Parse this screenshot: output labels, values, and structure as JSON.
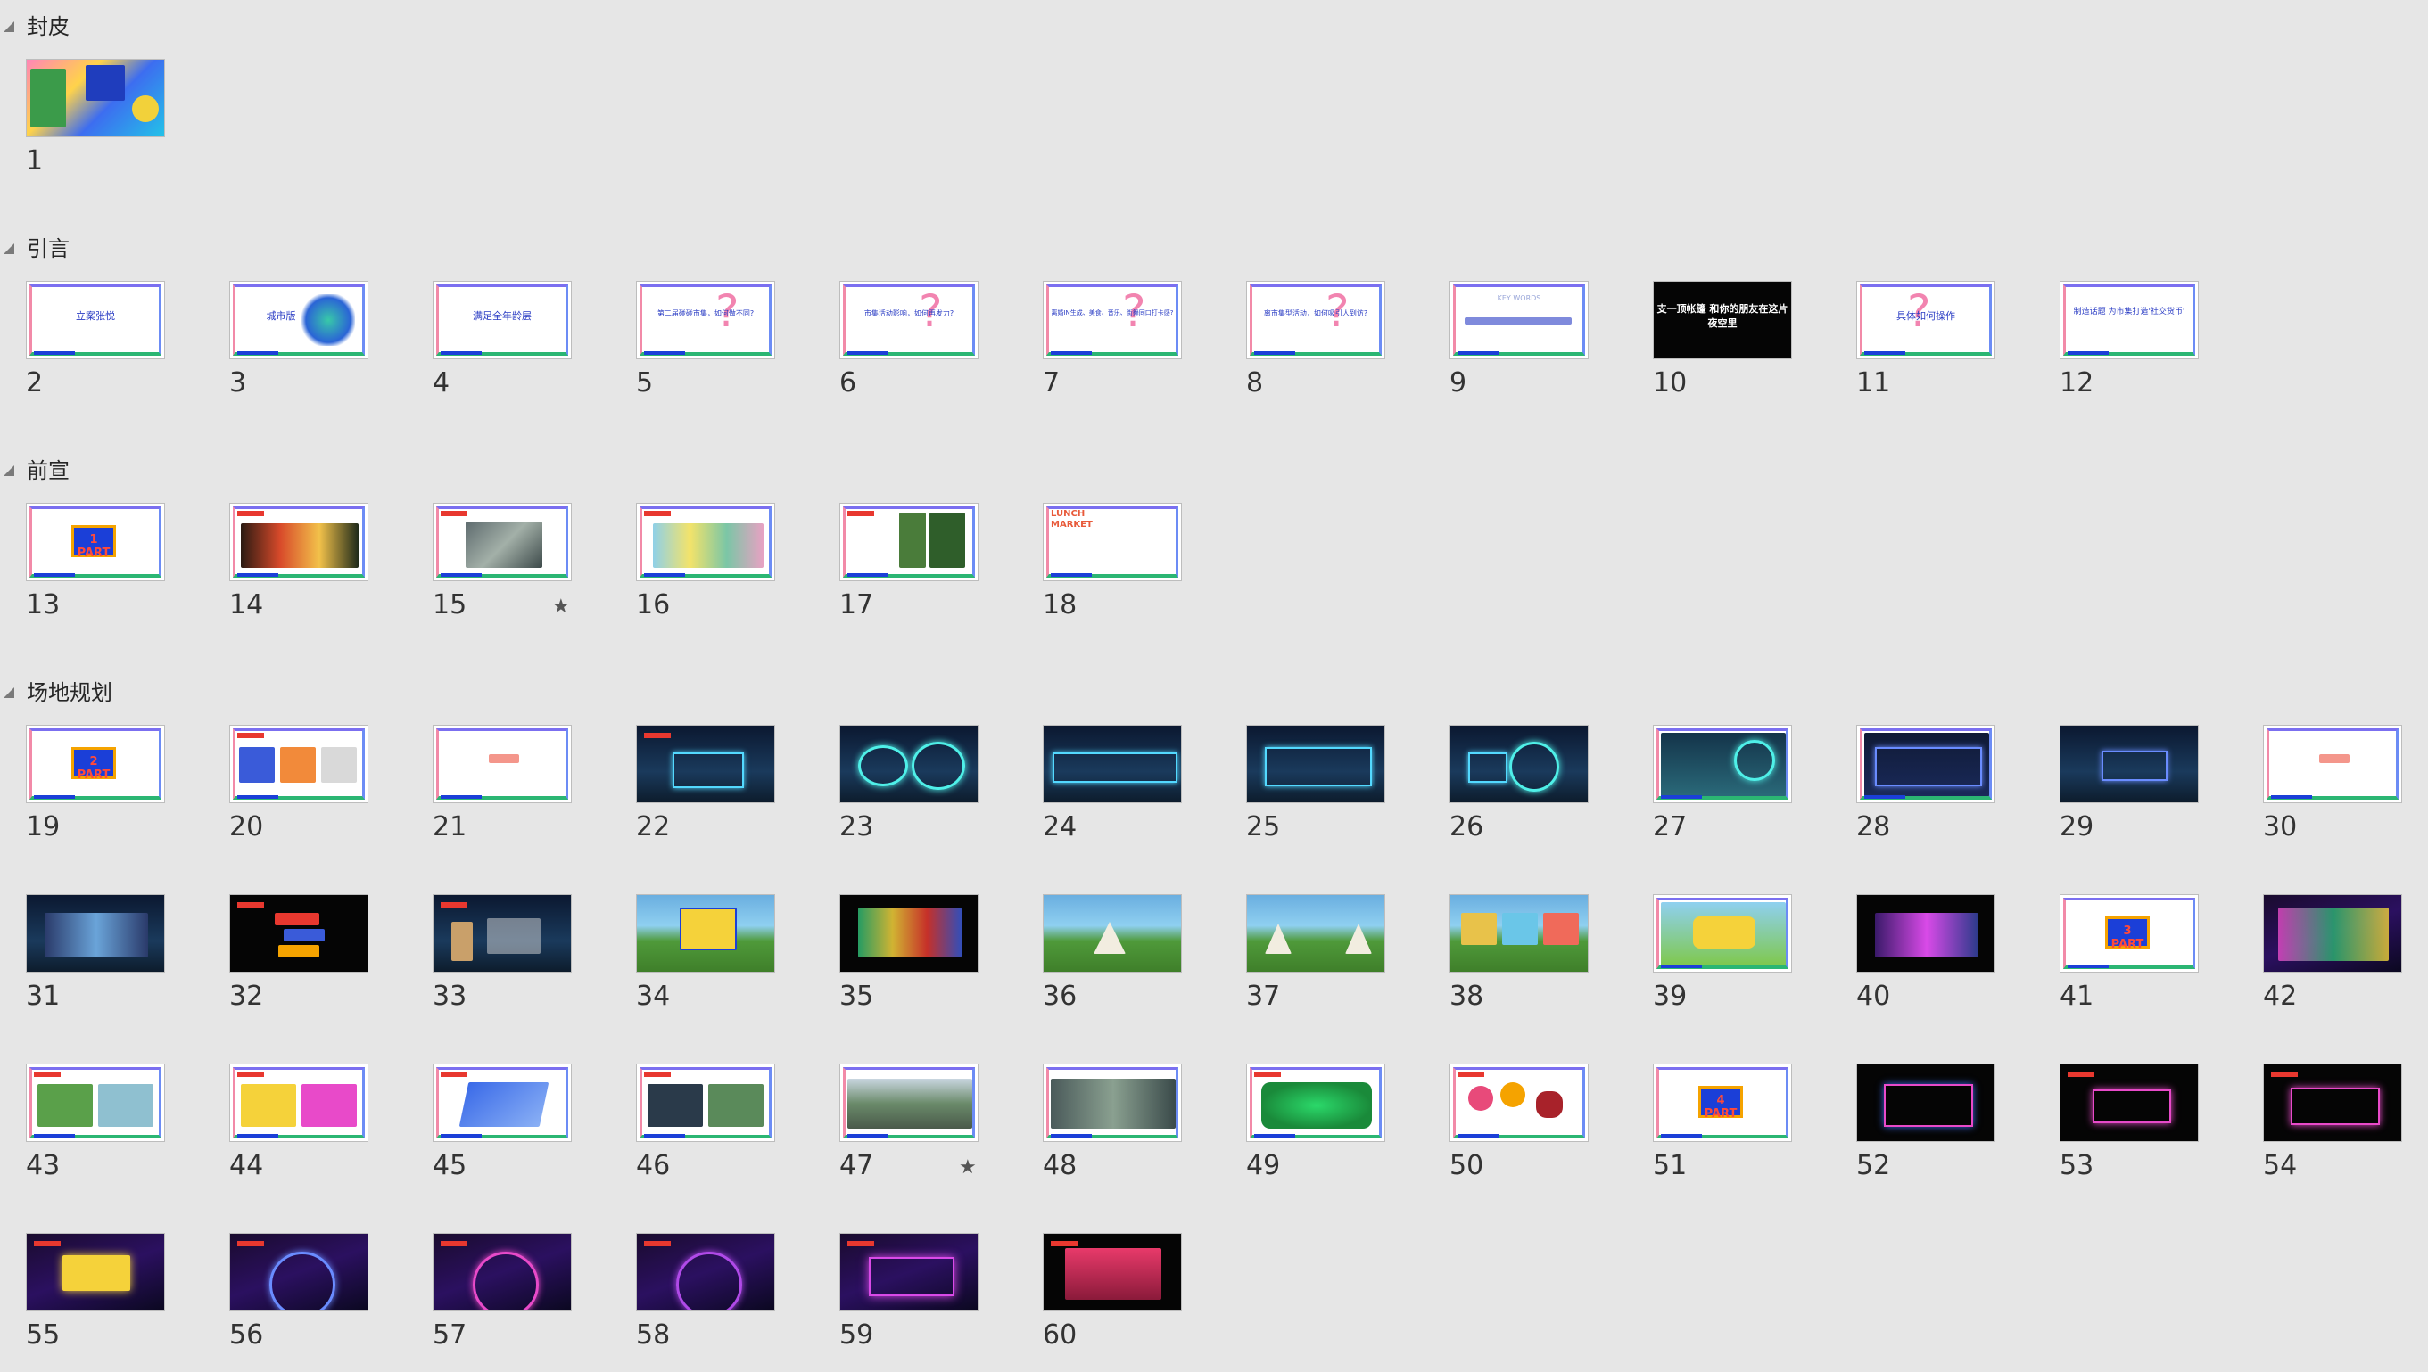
{
  "sections": [
    {
      "title": "封皮",
      "slides": [
        {
          "n": "1"
        }
      ]
    },
    {
      "title": "引言",
      "slides": [
        {
          "n": "2",
          "text": "立案张悦"
        },
        {
          "n": "3",
          "text": "城市版"
        },
        {
          "n": "4",
          "text": "满足全年龄层"
        },
        {
          "n": "5",
          "text": "第二届碰碰市集，如何做不同?"
        },
        {
          "n": "6",
          "text": "市集活动影响，如何再发力?"
        },
        {
          "n": "7",
          "text": "离婚IN生成、美食、音乐、街舞同口打卡感?"
        },
        {
          "n": "8",
          "text": "离市集型活动，如何吸引人到访?"
        },
        {
          "n": "9",
          "text": "KEY WORDS"
        },
        {
          "n": "10",
          "text": "支一顶帐篷 和你的朋友在这片夜空里"
        },
        {
          "n": "11",
          "text": "具体如何操作"
        },
        {
          "n": "12",
          "text": "制造话题 为市集打造'社交货币'"
        }
      ]
    },
    {
      "title": "前宣",
      "slides": [
        {
          "n": "13",
          "text": "1 PART"
        },
        {
          "n": "14"
        },
        {
          "n": "15",
          "star": true
        },
        {
          "n": "16"
        },
        {
          "n": "17"
        },
        {
          "n": "18",
          "text": "LUNCH MARKET"
        }
      ]
    },
    {
      "title": "场地规划",
      "slides": [
        {
          "n": "19",
          "text": "2 PART"
        },
        {
          "n": "20"
        },
        {
          "n": "21"
        },
        {
          "n": "22"
        },
        {
          "n": "23"
        },
        {
          "n": "24"
        },
        {
          "n": "25"
        },
        {
          "n": "26"
        },
        {
          "n": "27"
        },
        {
          "n": "28"
        },
        {
          "n": "29"
        },
        {
          "n": "30"
        },
        {
          "n": "31"
        },
        {
          "n": "32"
        },
        {
          "n": "33"
        },
        {
          "n": "34"
        },
        {
          "n": "35"
        },
        {
          "n": "36"
        },
        {
          "n": "37"
        },
        {
          "n": "38"
        },
        {
          "n": "39"
        },
        {
          "n": "40"
        },
        {
          "n": "41",
          "text": "3 PART"
        },
        {
          "n": "42"
        },
        {
          "n": "43"
        },
        {
          "n": "44"
        },
        {
          "n": "45"
        },
        {
          "n": "46"
        },
        {
          "n": "47",
          "star": true
        },
        {
          "n": "48"
        },
        {
          "n": "49"
        },
        {
          "n": "50"
        },
        {
          "n": "51",
          "text": "4 PART"
        },
        {
          "n": "52"
        },
        {
          "n": "53"
        },
        {
          "n": "54"
        },
        {
          "n": "55"
        },
        {
          "n": "56"
        },
        {
          "n": "57"
        },
        {
          "n": "58"
        },
        {
          "n": "59"
        },
        {
          "n": "60"
        }
      ]
    }
  ],
  "icons": {
    "star": "★",
    "collapse": "triangle-collapse-icon"
  }
}
